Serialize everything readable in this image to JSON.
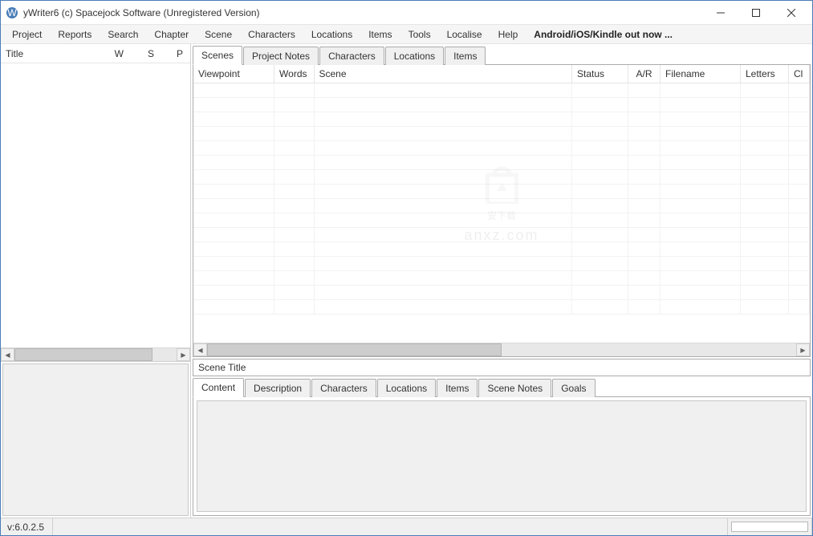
{
  "titlebar": {
    "title": "yWriter6 (c) Spacejock Software (Unregistered Version)"
  },
  "menu": {
    "items": [
      "Project",
      "Reports",
      "Search",
      "Chapter",
      "Scene",
      "Characters",
      "Locations",
      "Items",
      "Tools",
      "Localise",
      "Help"
    ],
    "promo": "Android/iOS/Kindle out now ..."
  },
  "chapter_panel": {
    "headers": {
      "title": "Title",
      "w": "W",
      "s": "S",
      "p": "P"
    }
  },
  "top_tabs": {
    "items": [
      "Scenes",
      "Project Notes",
      "Characters",
      "Locations",
      "Items"
    ],
    "active": 0
  },
  "scene_grid": {
    "headers": {
      "viewpoint": "Viewpoint",
      "words": "Words",
      "scene": "Scene",
      "status": "Status",
      "ar": "A/R",
      "filename": "Filename",
      "letters": "Letters",
      "cl": "Cl"
    }
  },
  "scene_title_label": "Scene Title",
  "bottom_tabs": {
    "items": [
      "Content",
      "Description",
      "Characters",
      "Locations",
      "Items",
      "Scene Notes",
      "Goals"
    ],
    "active": 0
  },
  "statusbar": {
    "version": "v:6.0.2.5"
  },
  "watermark": {
    "main": "安下载",
    "sub": "anxz.com"
  }
}
